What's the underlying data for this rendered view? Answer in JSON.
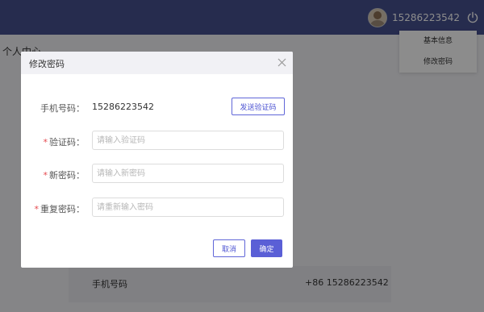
{
  "header": {
    "phone": "15286223542",
    "power_icon": "power-icon"
  },
  "background": {
    "page_title": "个人中心",
    "profile_phone_label": "手机号码",
    "profile_phone_value": "+86 15286223542"
  },
  "user_menu": {
    "items": [
      "基本信息",
      "修改密码"
    ]
  },
  "dialog": {
    "title": "修改密码",
    "phone_label": "手机号码：",
    "phone_value": "15286223542",
    "send_code_label": "发送验证码",
    "code_label": "验证码：",
    "code_placeholder": "请输入验证码",
    "new_password_label": "新密码：",
    "new_password_placeholder": "请输入新密码",
    "repeat_password_label": "重复密码：",
    "repeat_password_placeholder": "请重新输入密码",
    "cancel_label": "取消",
    "confirm_label": "确定",
    "required_mark": "*"
  },
  "colors": {
    "topbar": "#46508f",
    "accent": "#5a5fd6",
    "required": "#e5484d"
  }
}
